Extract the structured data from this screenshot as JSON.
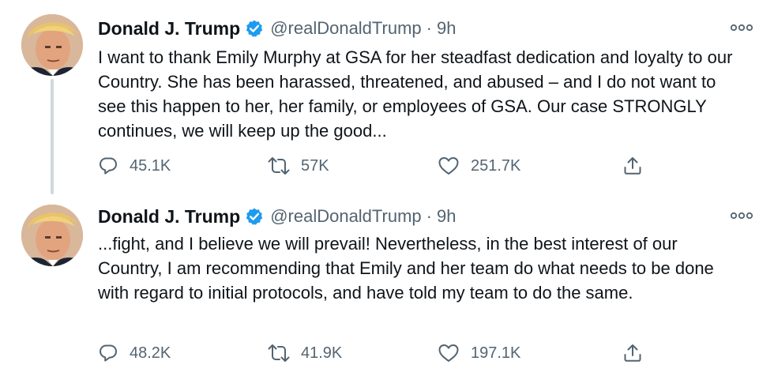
{
  "colors": {
    "verified": "#1d9bf0",
    "text": "#0f1419",
    "secondary": "#536471",
    "thread_line": "#cfd9de"
  },
  "icons": {
    "avatar": "profile-photo",
    "verified": "verified-badge-icon",
    "more": "more-options-icon",
    "reply": "reply-icon",
    "retweet": "retweet-icon",
    "like": "heart-icon",
    "share": "share-icon"
  },
  "tweets": [
    {
      "name": "Donald J. Trump",
      "handle": "@realDonaldTrump",
      "separator": "·",
      "time": "9h",
      "text": "I want to thank Emily Murphy at GSA for her steadfast dedication and loyalty to our Country. She has been harassed, threatened, and abused – and I do not want to see this happen to her, her family, or employees of GSA. Our case STRONGLY continues, we will keep up the good...",
      "replies": "45.1K",
      "retweets": "57K",
      "likes": "251.7K"
    },
    {
      "name": "Donald J. Trump",
      "handle": "@realDonaldTrump",
      "separator": "·",
      "time": "9h",
      "text": "...fight, and I believe we will prevail! Nevertheless, in the best interest of our Country, I am recommending that Emily and her team do what needs to be done with regard to initial protocols, and have told my team to do the same.",
      "replies": "48.2K",
      "retweets": "41.9K",
      "likes": "197.1K"
    }
  ]
}
